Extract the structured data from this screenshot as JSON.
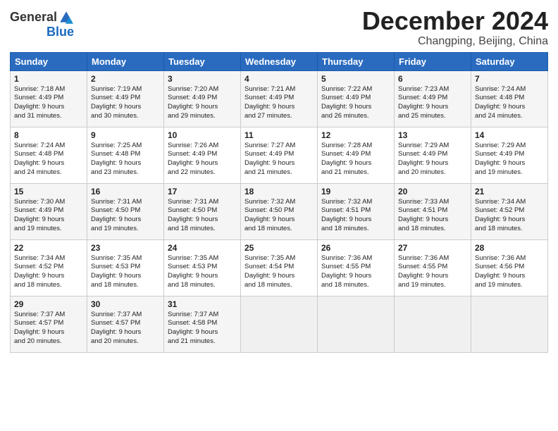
{
  "header": {
    "logo_line1": "General",
    "logo_line2": "Blue",
    "month": "December 2024",
    "location": "Changping, Beijing, China"
  },
  "weekdays": [
    "Sunday",
    "Monday",
    "Tuesday",
    "Wednesday",
    "Thursday",
    "Friday",
    "Saturday"
  ],
  "weeks": [
    [
      {
        "day": "1",
        "lines": [
          "Sunrise: 7:18 AM",
          "Sunset: 4:49 PM",
          "Daylight: 9 hours",
          "and 31 minutes."
        ]
      },
      {
        "day": "2",
        "lines": [
          "Sunrise: 7:19 AM",
          "Sunset: 4:49 PM",
          "Daylight: 9 hours",
          "and 30 minutes."
        ]
      },
      {
        "day": "3",
        "lines": [
          "Sunrise: 7:20 AM",
          "Sunset: 4:49 PM",
          "Daylight: 9 hours",
          "and 29 minutes."
        ]
      },
      {
        "day": "4",
        "lines": [
          "Sunrise: 7:21 AM",
          "Sunset: 4:49 PM",
          "Daylight: 9 hours",
          "and 27 minutes."
        ]
      },
      {
        "day": "5",
        "lines": [
          "Sunrise: 7:22 AM",
          "Sunset: 4:49 PM",
          "Daylight: 9 hours",
          "and 26 minutes."
        ]
      },
      {
        "day": "6",
        "lines": [
          "Sunrise: 7:23 AM",
          "Sunset: 4:49 PM",
          "Daylight: 9 hours",
          "and 25 minutes."
        ]
      },
      {
        "day": "7",
        "lines": [
          "Sunrise: 7:24 AM",
          "Sunset: 4:48 PM",
          "Daylight: 9 hours",
          "and 24 minutes."
        ]
      }
    ],
    [
      {
        "day": "8",
        "lines": [
          "Sunrise: 7:24 AM",
          "Sunset: 4:48 PM",
          "Daylight: 9 hours",
          "and 24 minutes."
        ]
      },
      {
        "day": "9",
        "lines": [
          "Sunrise: 7:25 AM",
          "Sunset: 4:48 PM",
          "Daylight: 9 hours",
          "and 23 minutes."
        ]
      },
      {
        "day": "10",
        "lines": [
          "Sunrise: 7:26 AM",
          "Sunset: 4:49 PM",
          "Daylight: 9 hours",
          "and 22 minutes."
        ]
      },
      {
        "day": "11",
        "lines": [
          "Sunrise: 7:27 AM",
          "Sunset: 4:49 PM",
          "Daylight: 9 hours",
          "and 21 minutes."
        ]
      },
      {
        "day": "12",
        "lines": [
          "Sunrise: 7:28 AM",
          "Sunset: 4:49 PM",
          "Daylight: 9 hours",
          "and 21 minutes."
        ]
      },
      {
        "day": "13",
        "lines": [
          "Sunrise: 7:29 AM",
          "Sunset: 4:49 PM",
          "Daylight: 9 hours",
          "and 20 minutes."
        ]
      },
      {
        "day": "14",
        "lines": [
          "Sunrise: 7:29 AM",
          "Sunset: 4:49 PM",
          "Daylight: 9 hours",
          "and 19 minutes."
        ]
      }
    ],
    [
      {
        "day": "15",
        "lines": [
          "Sunrise: 7:30 AM",
          "Sunset: 4:49 PM",
          "Daylight: 9 hours",
          "and 19 minutes."
        ]
      },
      {
        "day": "16",
        "lines": [
          "Sunrise: 7:31 AM",
          "Sunset: 4:50 PM",
          "Daylight: 9 hours",
          "and 19 minutes."
        ]
      },
      {
        "day": "17",
        "lines": [
          "Sunrise: 7:31 AM",
          "Sunset: 4:50 PM",
          "Daylight: 9 hours",
          "and 18 minutes."
        ]
      },
      {
        "day": "18",
        "lines": [
          "Sunrise: 7:32 AM",
          "Sunset: 4:50 PM",
          "Daylight: 9 hours",
          "and 18 minutes."
        ]
      },
      {
        "day": "19",
        "lines": [
          "Sunrise: 7:32 AM",
          "Sunset: 4:51 PM",
          "Daylight: 9 hours",
          "and 18 minutes."
        ]
      },
      {
        "day": "20",
        "lines": [
          "Sunrise: 7:33 AM",
          "Sunset: 4:51 PM",
          "Daylight: 9 hours",
          "and 18 minutes."
        ]
      },
      {
        "day": "21",
        "lines": [
          "Sunrise: 7:34 AM",
          "Sunset: 4:52 PM",
          "Daylight: 9 hours",
          "and 18 minutes."
        ]
      }
    ],
    [
      {
        "day": "22",
        "lines": [
          "Sunrise: 7:34 AM",
          "Sunset: 4:52 PM",
          "Daylight: 9 hours",
          "and 18 minutes."
        ]
      },
      {
        "day": "23",
        "lines": [
          "Sunrise: 7:35 AM",
          "Sunset: 4:53 PM",
          "Daylight: 9 hours",
          "and 18 minutes."
        ]
      },
      {
        "day": "24",
        "lines": [
          "Sunrise: 7:35 AM",
          "Sunset: 4:53 PM",
          "Daylight: 9 hours",
          "and 18 minutes."
        ]
      },
      {
        "day": "25",
        "lines": [
          "Sunrise: 7:35 AM",
          "Sunset: 4:54 PM",
          "Daylight: 9 hours",
          "and 18 minutes."
        ]
      },
      {
        "day": "26",
        "lines": [
          "Sunrise: 7:36 AM",
          "Sunset: 4:55 PM",
          "Daylight: 9 hours",
          "and 18 minutes."
        ]
      },
      {
        "day": "27",
        "lines": [
          "Sunrise: 7:36 AM",
          "Sunset: 4:55 PM",
          "Daylight: 9 hours",
          "and 19 minutes."
        ]
      },
      {
        "day": "28",
        "lines": [
          "Sunrise: 7:36 AM",
          "Sunset: 4:56 PM",
          "Daylight: 9 hours",
          "and 19 minutes."
        ]
      }
    ],
    [
      {
        "day": "29",
        "lines": [
          "Sunrise: 7:37 AM",
          "Sunset: 4:57 PM",
          "Daylight: 9 hours",
          "and 20 minutes."
        ]
      },
      {
        "day": "30",
        "lines": [
          "Sunrise: 7:37 AM",
          "Sunset: 4:57 PM",
          "Daylight: 9 hours",
          "and 20 minutes."
        ]
      },
      {
        "day": "31",
        "lines": [
          "Sunrise: 7:37 AM",
          "Sunset: 4:58 PM",
          "Daylight: 9 hours",
          "and 21 minutes."
        ]
      },
      null,
      null,
      null,
      null
    ]
  ]
}
